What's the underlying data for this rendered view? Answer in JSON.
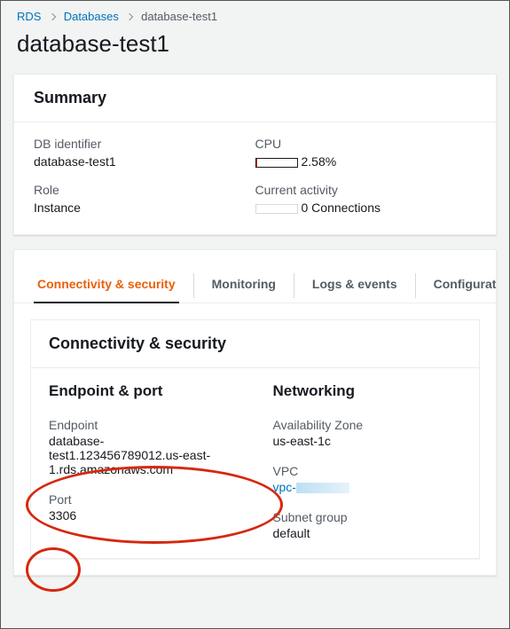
{
  "breadcrumb": {
    "root": "RDS",
    "level1": "Databases",
    "current": "database-test1"
  },
  "page_title": "database-test1",
  "summary": {
    "header": "Summary",
    "db_identifier_label": "DB identifier",
    "db_identifier_value": "database-test1",
    "role_label": "Role",
    "role_value": "Instance",
    "cpu_label": "CPU",
    "cpu_value": "2.58%",
    "cpu_percent_numeric": 2.58,
    "activity_label": "Current activity",
    "activity_value": "0 Connections"
  },
  "tabs": {
    "t0": "Connectivity & security",
    "t1": "Monitoring",
    "t2": "Logs & events",
    "t3": "Configuration"
  },
  "conn": {
    "panel_title": "Connectivity & security",
    "endpoint_section": "Endpoint & port",
    "endpoint_label": "Endpoint",
    "endpoint_value": "database-test1.123456789012.us-east-1.rds.amazonaws.com",
    "port_label": "Port",
    "port_value": "3306",
    "networking_section": "Networking",
    "az_label": "Availability Zone",
    "az_value": "us-east-1c",
    "vpc_label": "VPC",
    "vpc_link_prefix": "vpc-",
    "subnet_label": "Subnet group",
    "subnet_value": "default"
  }
}
